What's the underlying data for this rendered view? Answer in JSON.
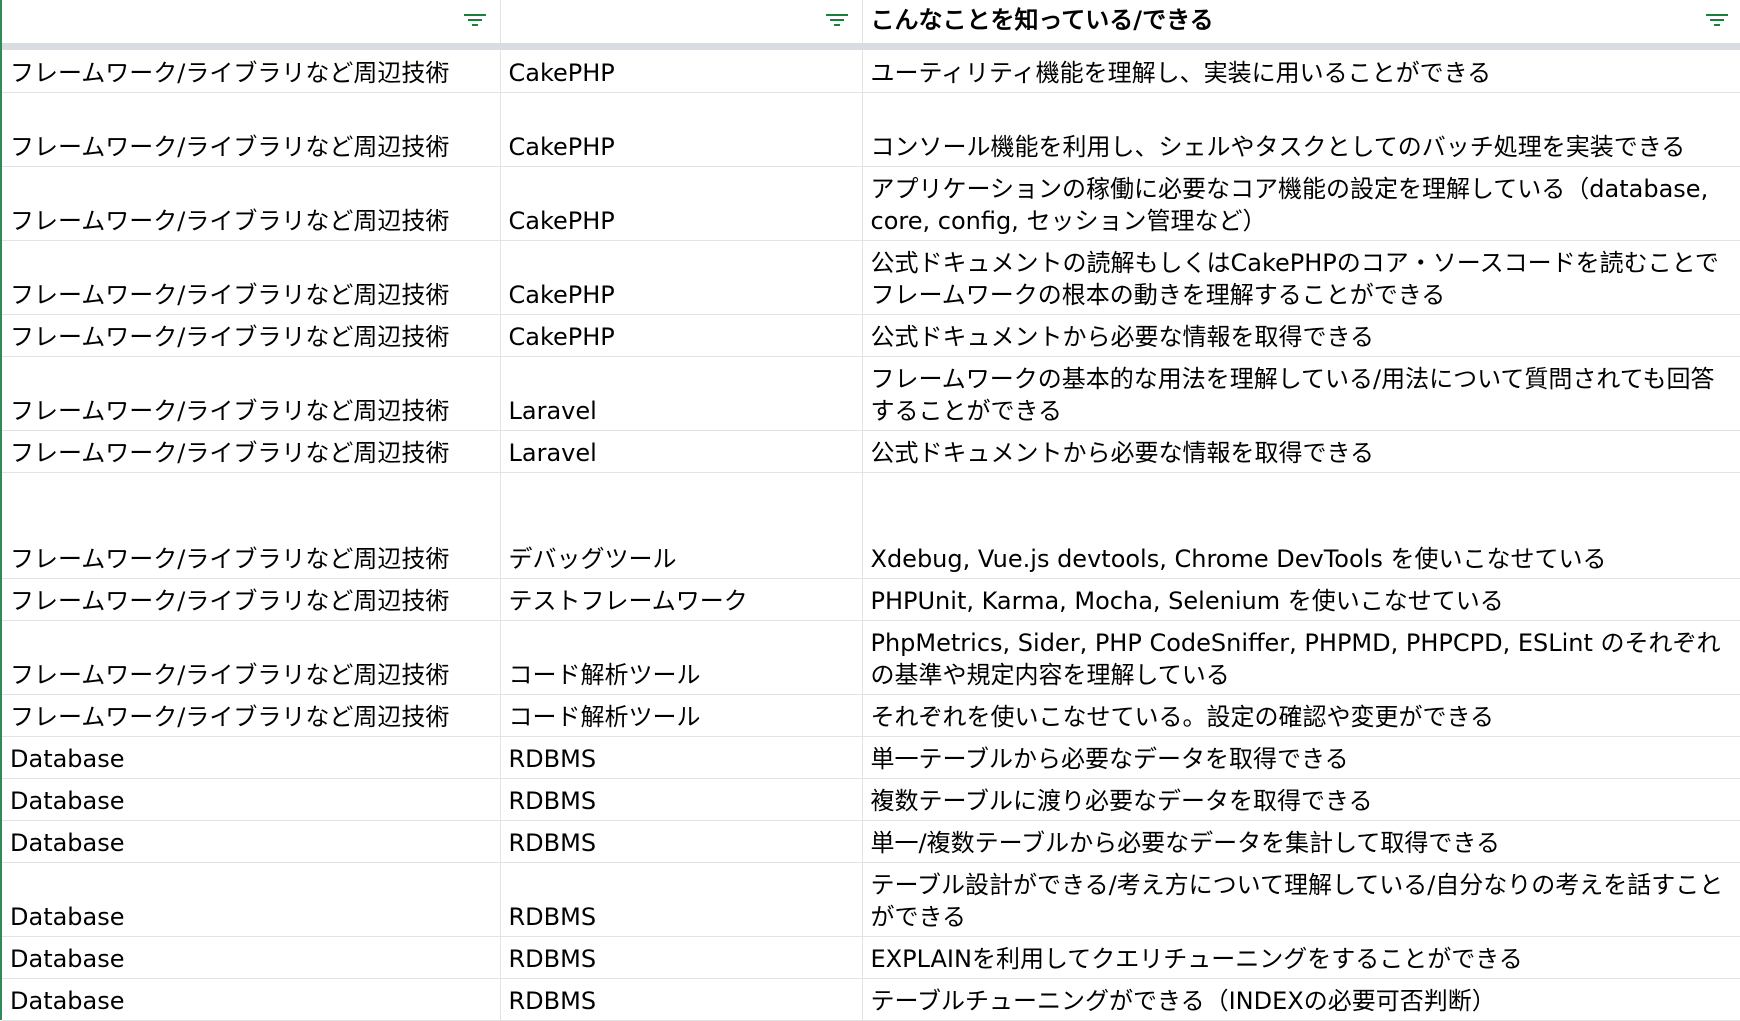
{
  "header": {
    "columns": [
      {
        "label": ""
      },
      {
        "label": ""
      },
      {
        "label": "こんなことを知っている/できる"
      }
    ]
  },
  "rows": [
    {
      "category": "フレームワーク/ライブラリなど周辺技術",
      "tech": "CakePHP",
      "skill": "ユーティリティ機能を理解し、実装に用いることができる"
    },
    {
      "category": "フレームワーク/ライブラリなど周辺技術",
      "tech": "CakePHP",
      "skill": "コンソール機能を利用し、シェルやタスクとしてのバッチ処理を実装できる"
    },
    {
      "category": "フレームワーク/ライブラリなど周辺技術",
      "tech": "CakePHP",
      "skill": "アプリケーションの稼働に必要なコア機能の設定を理解している（database, core, config, セッション管理など）"
    },
    {
      "category": "フレームワーク/ライブラリなど周辺技術",
      "tech": "CakePHP",
      "skill": "公式ドキュメントの読解もしくはCakePHPのコア・ソースコードを読むことでフレームワークの根本の動きを理解することができる"
    },
    {
      "category": "フレームワーク/ライブラリなど周辺技術",
      "tech": "CakePHP",
      "skill": "公式ドキュメントから必要な情報を取得できる"
    },
    {
      "category": "フレームワーク/ライブラリなど周辺技術",
      "tech": "Laravel",
      "skill": "フレームワークの基本的な用法を理解している/用法について質問されても回答することができる"
    },
    {
      "category": "フレームワーク/ライブラリなど周辺技術",
      "tech": "Laravel",
      "skill": "公式ドキュメントから必要な情報を取得できる"
    },
    {
      "category": "フレームワーク/ライブラリなど周辺技術",
      "tech": "デバッグツール",
      "skill": "Xdebug, Vue.js devtools, Chrome DevTools を使いこなせている"
    },
    {
      "category": "フレームワーク/ライブラリなど周辺技術",
      "tech": "テストフレームワーク",
      "skill": "PHPUnit, Karma, Mocha, Selenium を使いこなせている"
    },
    {
      "category": "フレームワーク/ライブラリなど周辺技術",
      "tech": "コード解析ツール",
      "skill": "PhpMetrics, Sider, PHP CodeSniffer, PHPMD, PHPCPD, ESLint のそれぞれの基準や規定内容を理解している"
    },
    {
      "category": "フレームワーク/ライブラリなど周辺技術",
      "tech": "コード解析ツール",
      "skill": "それぞれを使いこなせている。設定の確認や変更ができる"
    },
    {
      "category": "Database",
      "tech": "RDBMS",
      "skill": "単一テーブルから必要なデータを取得できる"
    },
    {
      "category": "Database",
      "tech": "RDBMS",
      "skill": "複数テーブルに渡り必要なデータを取得できる"
    },
    {
      "category": "Database",
      "tech": "RDBMS",
      "skill": "単一/複数テーブルから必要なデータを集計して取得できる"
    },
    {
      "category": "Database",
      "tech": "RDBMS",
      "skill": "テーブル設計ができる/考え方について理解している/自分なりの考えを話すことができる"
    },
    {
      "category": "Database",
      "tech": "RDBMS",
      "skill": "EXPLAINを利用してクエリチューニングをすることができる"
    },
    {
      "category": "Database",
      "tech": "RDBMS",
      "skill": "テーブルチューニングができる（INDEXの必要可否判断）"
    }
  ],
  "colors": {
    "filter_icon": "#188038",
    "grid_line": "#e2e3e3",
    "frozen_divider": "#d9dce0",
    "left_border": "#2e8b57"
  },
  "icons": {
    "filter": "filter-icon"
  }
}
